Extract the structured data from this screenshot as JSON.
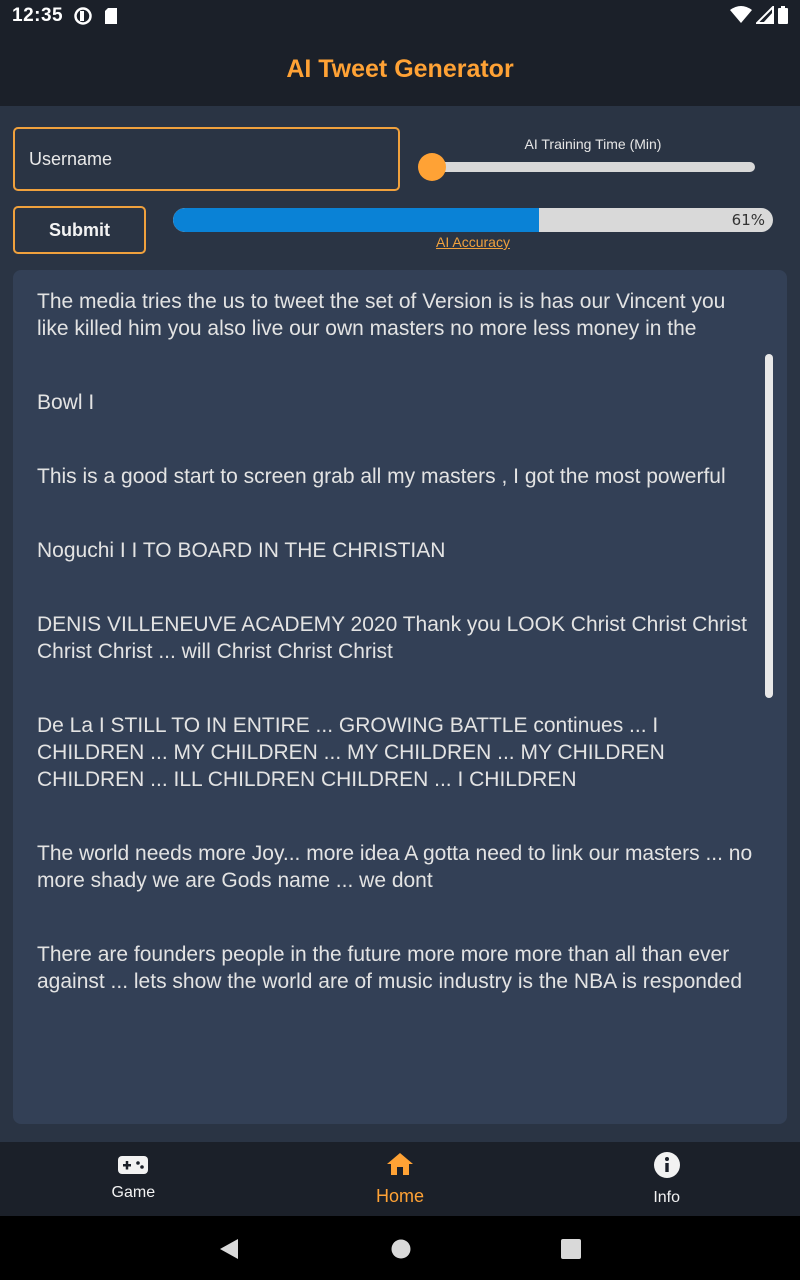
{
  "status_bar": {
    "time": "12:35"
  },
  "app": {
    "title": "AI Tweet Generator"
  },
  "form": {
    "username_placeholder": "Username",
    "slider_label": "AI Training Time (Min)",
    "slider_value_fraction": 0.0,
    "submit_label": "Submit"
  },
  "accuracy": {
    "percent": 61,
    "text": "61%",
    "label": "AI Accuracy"
  },
  "tweets": [
    "The media tries the us to tweet the set of Version is is has our Vincent you like killed him you also live our own masters no more less money in the",
    "Bowl  I",
    "This is a good start to screen grab all my masters , I got the most powerful",
    "Noguchi  I I TO BOARD IN THE CHRISTIAN",
    "DENIS VILLENEUVE ACADEMY 2020 Thank you LOOK Christ Christ Christ Christ Christ ... will Christ Christ Christ",
    "De La I STILL TO IN ENTIRE ... GROWING BATTLE continues ... I CHILDREN ... MY CHILDREN ... MY CHILDREN ... MY CHILDREN CHILDREN ... ILL CHILDREN CHILDREN ... I CHILDREN",
    "The world needs more Joy... more idea A gotta need to link our masters ... no more shady we are Gods name ... we dont",
    "There are founders people in the future more more more than all than ever against ... lets show the world are of music industry is the NBA is responded"
  ],
  "nav": {
    "items": [
      {
        "label": "Game",
        "icon": "gamepad-icon"
      },
      {
        "label": "Home",
        "icon": "home-icon",
        "active": true
      },
      {
        "label": "Info",
        "icon": "info-icon"
      }
    ]
  },
  "colors": {
    "accent": "#ffa235",
    "progress": "#0a82d6",
    "panel": "#334056",
    "background": "#2a3444",
    "bar": "#1b2029"
  }
}
